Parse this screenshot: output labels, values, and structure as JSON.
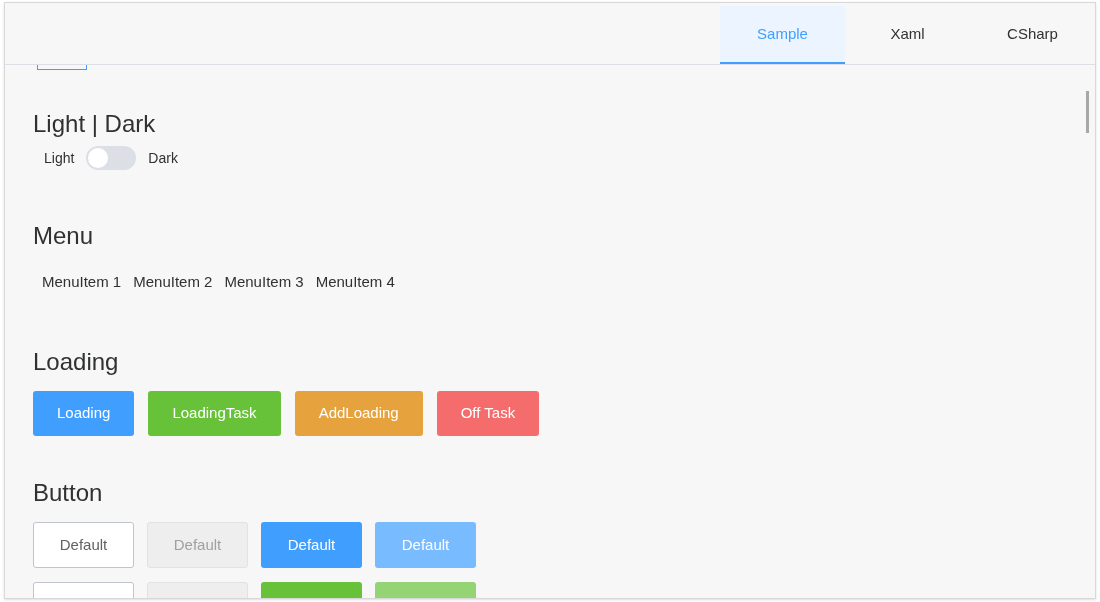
{
  "tabs": [
    {
      "label": "Sample",
      "selected": true
    },
    {
      "label": "Xaml",
      "selected": false
    },
    {
      "label": "CSharp",
      "selected": false
    }
  ],
  "sections": [
    {
      "kind": "theme",
      "title": "Light | Dark",
      "left_label": "Light",
      "right_label": "Dark",
      "on": false
    },
    {
      "kind": "menu",
      "title": "Menu",
      "items": [
        "MenuItem 1",
        "MenuItem 2",
        "MenuItem 3",
        "MenuItem 4"
      ]
    },
    {
      "kind": "loading",
      "title": "Loading",
      "buttons": [
        {
          "label": "Loading",
          "color": "#409eff"
        },
        {
          "label": "LoadingTask",
          "color": "#67c23a"
        },
        {
          "label": "AddLoading",
          "color": "#e6a23c"
        },
        {
          "label": "Off Task",
          "color": "#f56c6c"
        }
      ]
    },
    {
      "kind": "buttons",
      "title": "Button",
      "rows": [
        [
          {
            "label": "Default",
            "kind": "default",
            "disabled": false
          },
          {
            "label": "Default",
            "kind": "default",
            "disabled": true
          },
          {
            "label": "Default",
            "kind": "primary",
            "disabled": false
          },
          {
            "label": "Default",
            "kind": "primary",
            "disabled": true
          }
        ],
        [
          {
            "kind": "default",
            "disabled": false
          },
          {
            "kind": "default",
            "disabled": true
          },
          {
            "kind": "success",
            "disabled": false
          },
          {
            "kind": "success",
            "disabled": true
          }
        ]
      ]
    }
  ]
}
